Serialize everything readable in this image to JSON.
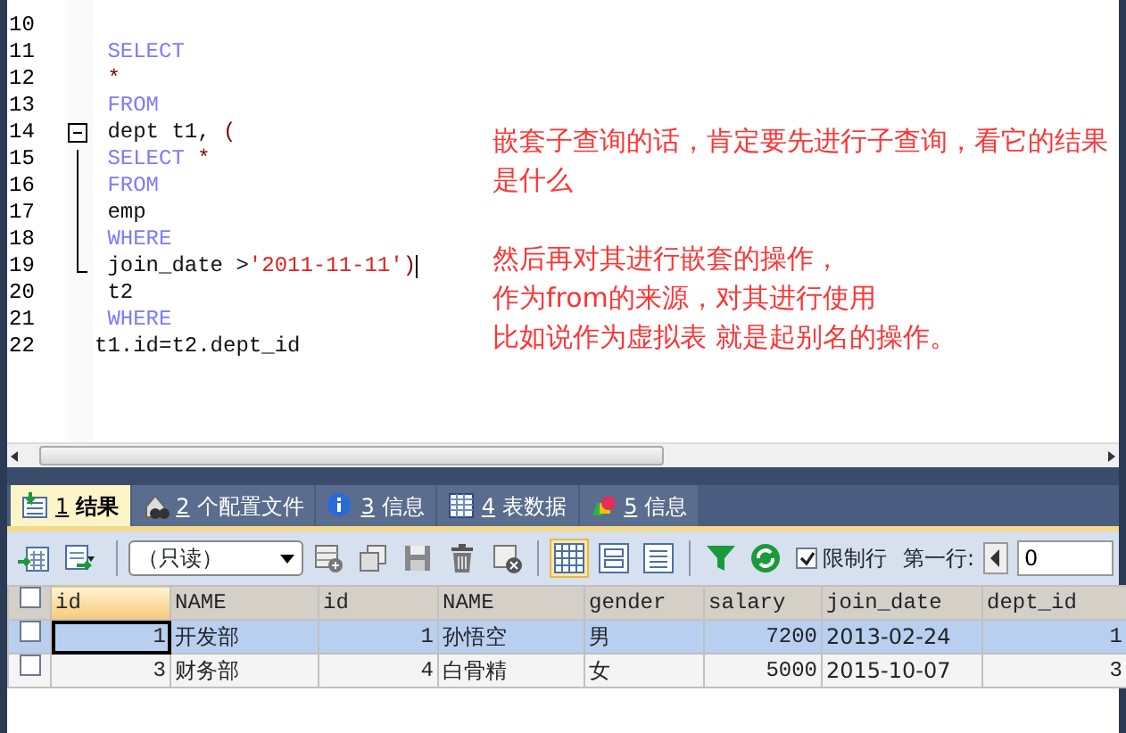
{
  "editor": {
    "lines": [
      {
        "number": "10",
        "kind": "plain"
      },
      {
        "number": "11",
        "kind": "plain",
        "tokens": [
          {
            "text": " SELECT",
            "kind": "keyword"
          }
        ]
      },
      {
        "number": "12",
        "kind": "plain",
        "tokens": [
          {
            "text": " *",
            "kind": "symbol"
          }
        ]
      },
      {
        "number": "13",
        "kind": "plain",
        "tokens": [
          {
            "text": " FROM",
            "kind": "keyword"
          }
        ]
      },
      {
        "number": "14",
        "kind": "foldstart",
        "tokens": [
          {
            "text": " dept t1, ",
            "kind": "plain"
          },
          {
            "text": "(",
            "kind": "symbol"
          }
        ]
      },
      {
        "number": "15",
        "kind": "foldbody",
        "tokens": [
          {
            "text": " SELECT ",
            "kind": "keyword"
          },
          {
            "text": "*",
            "kind": "symbol"
          }
        ]
      },
      {
        "number": "16",
        "kind": "foldbody",
        "tokens": [
          {
            "text": " FROM",
            "kind": "keyword"
          }
        ]
      },
      {
        "number": "17",
        "kind": "foldbody",
        "tokens": [
          {
            "text": " emp",
            "kind": "plain"
          }
        ]
      },
      {
        "number": "18",
        "kind": "foldbody",
        "tokens": [
          {
            "text": " WHERE",
            "kind": "keyword"
          }
        ]
      },
      {
        "number": "19",
        "kind": "foldend",
        "cursor": true,
        "tokens": [
          {
            "text": " join_date >",
            "kind": "plain"
          },
          {
            "text": "'2011-11-11'",
            "kind": "string"
          },
          {
            "text": ")",
            "kind": "symbol"
          }
        ]
      },
      {
        "number": "20",
        "kind": "plain",
        "tokens": [
          {
            "text": " t2",
            "kind": "plain"
          }
        ]
      },
      {
        "number": "21",
        "kind": "plain",
        "tokens": [
          {
            "text": " WHERE",
            "kind": "keyword"
          }
        ]
      },
      {
        "number": "22",
        "kind": "plain",
        "tokens": [
          {
            "text": "t1.id=t2.dept_id",
            "kind": "plain"
          }
        ]
      }
    ],
    "notes": [
      [
        "嵌套子查询的话，肯定要先进行子查询，看它的结果是什么"
      ],
      [
        "然后再对其进行嵌套的操作，",
        "作为from的来源，对其进行使用",
        "比如说作为虚拟表 就是起别名的操作。"
      ]
    ]
  },
  "tabs": [
    {
      "number": "1",
      "label": "结果",
      "selected": true
    },
    {
      "number": "2",
      "label": "个配置文件",
      "selected": false
    },
    {
      "number": "3",
      "label": "信息",
      "selected": false
    },
    {
      "number": "4",
      "label": "表数据",
      "selected": false
    },
    {
      "number": "5",
      "label": "信息",
      "selected": false
    }
  ],
  "toolbar": {
    "mode": "（只读）",
    "views": [
      {
        "selected": true
      },
      {
        "selected": false
      },
      {
        "selected": false
      }
    ],
    "limit_rows": {
      "label": "限制行",
      "checked": true
    },
    "first_row": {
      "label": "第一行:",
      "value": "0"
    }
  },
  "table": {
    "select_all_checked": false,
    "columns": [
      {
        "label": "id",
        "kind": "number",
        "highlighted": true
      },
      {
        "label": "NAME",
        "kind": "text",
        "highlighted": false
      },
      {
        "label": "id",
        "kind": "number",
        "highlighted": false
      },
      {
        "label": "NAME",
        "kind": "text",
        "highlighted": false
      },
      {
        "label": "gender",
        "kind": "text",
        "highlighted": false
      },
      {
        "label": "salary",
        "kind": "number",
        "highlighted": false
      },
      {
        "label": "join_date",
        "kind": "text",
        "highlighted": false
      },
      {
        "label": "dept_id",
        "kind": "number",
        "highlighted": false
      }
    ],
    "rows": [
      {
        "selected": true,
        "checked": false,
        "first_cell_focused": true,
        "cells": [
          "1",
          "开发部",
          "1",
          "孙悟空",
          "男",
          "7200",
          "2013-02-24",
          "1"
        ]
      },
      {
        "selected": false,
        "checked": false,
        "first_cell_focused": false,
        "cells": [
          "3",
          "财务部",
          "4",
          "白骨精",
          "女",
          "5000",
          "2015-10-07",
          "3"
        ]
      }
    ]
  }
}
